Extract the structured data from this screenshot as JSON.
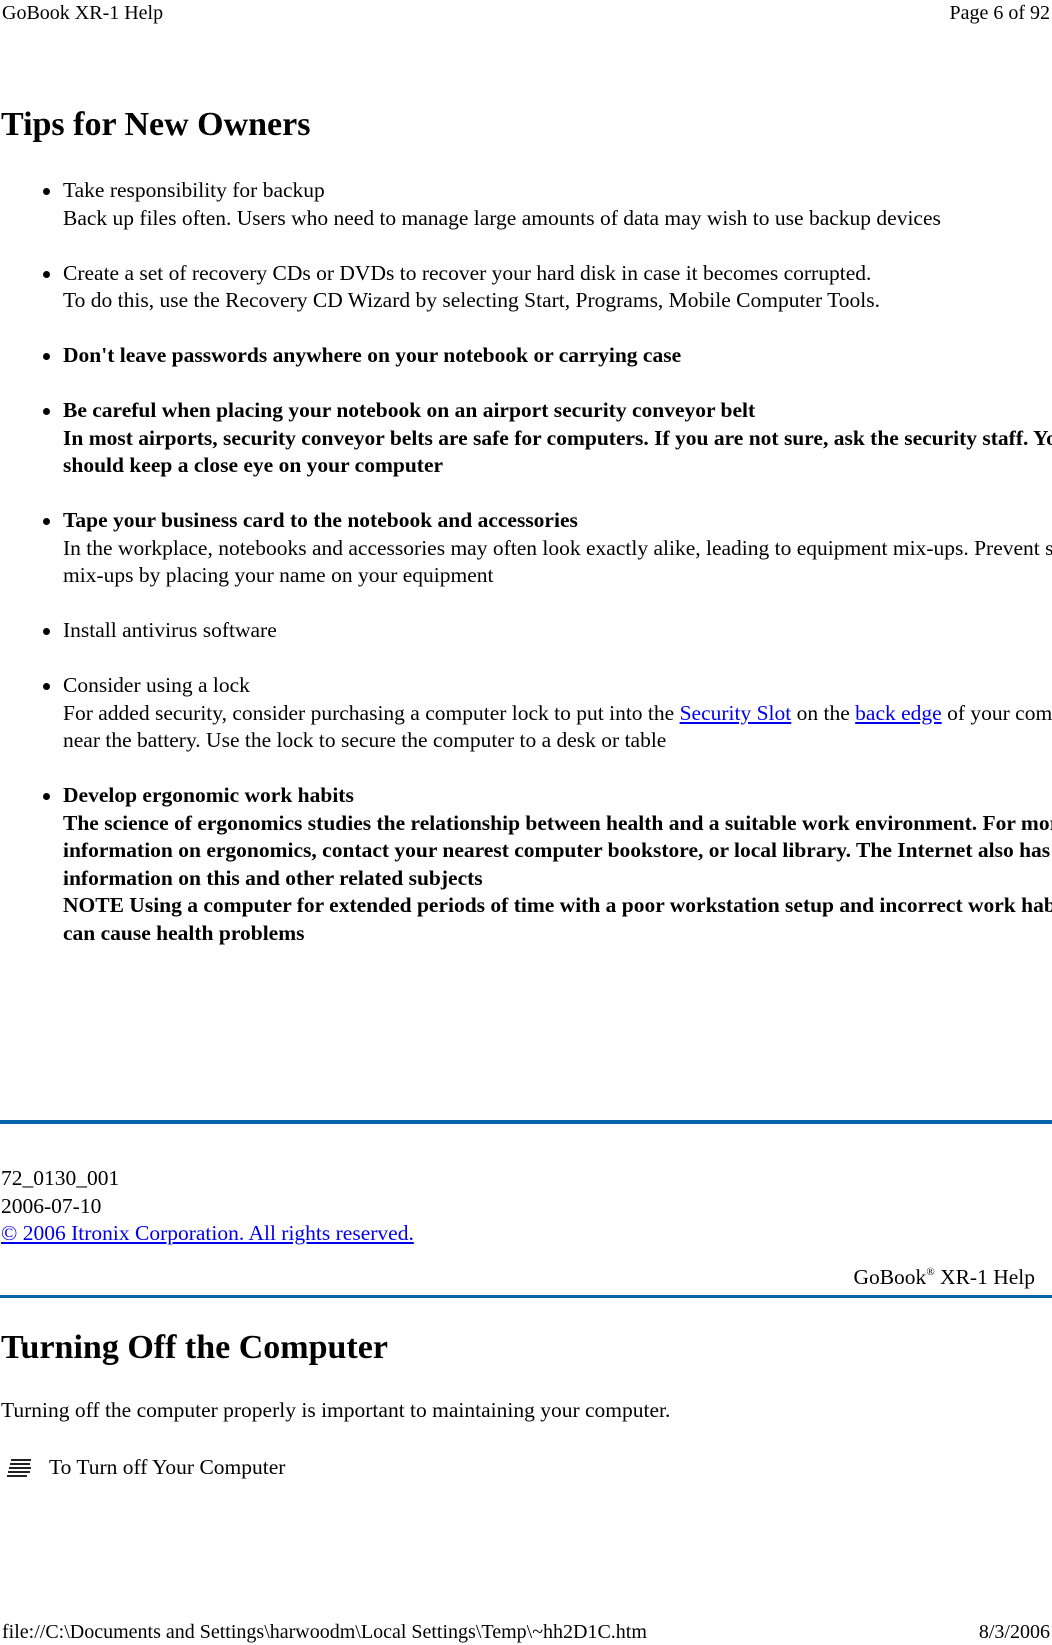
{
  "print_header": {
    "doc_title": "GoBook XR-1 Help",
    "page_indicator": "Page 6 of 92"
  },
  "section1": {
    "title": "Tips for New Owners",
    "items": [
      {
        "heading": "Take responsibility for backup",
        "body": "Back up files often. Users who need to manage large amounts of data may wish to use backup devices",
        "bold": false
      },
      {
        "heading": "Create a set of recovery CDs or DVDs to recover your hard disk in case it becomes corrupted.",
        "body": "To do this, use the Recovery CD Wizard by selecting Start, Programs, Mobile Computer Tools.",
        "bold": false
      },
      {
        "heading": "Don't leave passwords anywhere on your notebook or carrying case",
        "body": "",
        "bold": true
      },
      {
        "heading": "Be careful when placing your notebook on an airport security conveyor belt",
        "body": "In most airports, security conveyor belts are safe for computers. If you are not sure, ask the security staff. You should keep a close eye on your computer",
        "bold": true
      },
      {
        "heading": "Tape your business card to the notebook and accessories",
        "body": "In the workplace, notebooks and accessories may often look exactly alike, leading to equipment mix-ups. Prevent such mix-ups by placing your name on your equipment",
        "bold": false,
        "heading_bold": true
      },
      {
        "heading": "Install antivirus software",
        "body": "",
        "bold": false
      },
      {
        "heading": "Consider using a lock",
        "body_before": "For added security, consider purchasing a computer lock to put into the ",
        "link1": "Security Slot",
        "body_mid": " on the ",
        "link2": "back edge",
        "body_after": " of your computer near the battery. Use the lock to secure the computer to a desk or table",
        "bold": false
      },
      {
        "heading": "Develop ergonomic work habits",
        "body": "The science of ergonomics studies the relationship between health and a suitable work environment. For more information on ergonomics, contact your nearest computer bookstore, or local library. The Internet also has information on this and other related subjects",
        "note": "NOTE  Using a computer for extended periods of time with a poor workstation setup and incorrect work habits can cause health problems",
        "bold": true
      }
    ]
  },
  "doc_footer": {
    "doc_id": "72_0130_001",
    "date": "2006-07-10",
    "copyright_link": "© 2006 Itronix Corporation. All rights reserved.",
    "brand": "GoBook",
    "brand_mark": "®",
    "brand_suffix": " XR-1 Help"
  },
  "section2": {
    "title": "Turning Off the Computer",
    "intro": "Turning off the computer properly is important to maintaining your computer.",
    "procedure_label": "To Turn off Your Computer",
    "procedure_icon": "procedure-lines-icon"
  },
  "print_footer": {
    "file_path": "file://C:\\Documents and Settings\\harwoodm\\Local Settings\\Temp\\~hh2D1C.htm",
    "print_date": "8/3/2006"
  },
  "colors": {
    "rule": "#0563ac",
    "link": "#0000ee"
  }
}
